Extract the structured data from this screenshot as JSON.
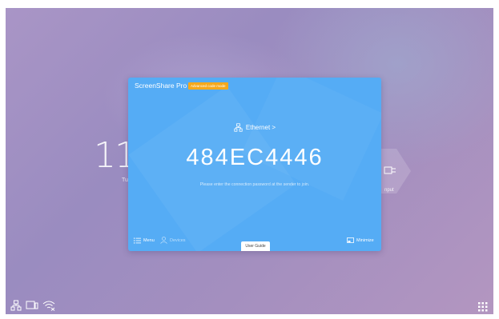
{
  "desktop": {
    "clock_time": "11",
    "clock_day": "Tu",
    "bg_tile_label": "nput"
  },
  "dialog": {
    "app_title": "ScreenShare Pro",
    "mode_badge": "Advanced code mode",
    "network_label": "Ethernet >",
    "pin_code": "484EC4446",
    "hint_text": "Please enter the connection password at the sender to join.",
    "menu_label": "Menu",
    "devices_label": "Devices",
    "user_guide_label": "User Guide",
    "minimize_label": "Minimize"
  },
  "taskbar": {
    "icons": [
      "network-icon",
      "screen-cast-icon",
      "wifi-off-icon"
    ],
    "apps_icon": "apps-grid-icon"
  },
  "colors": {
    "dialog_bg": "#55acf5",
    "badge_bg": "#f5a81c",
    "desktop_bg": "#a995c6"
  }
}
